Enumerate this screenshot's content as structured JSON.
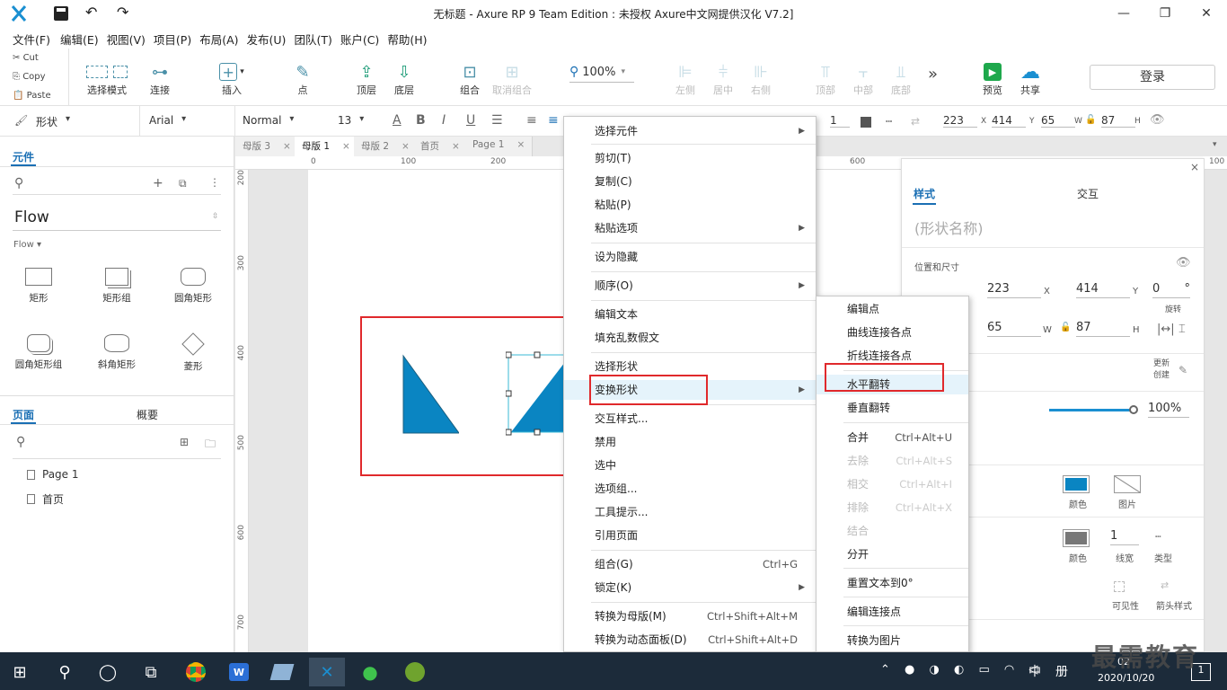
{
  "window": {
    "title": "无标题 - Axure RP 9 Team Edition : 未授权    Axure中文网提供汉化 V7.2]",
    "min": "—",
    "max": "❐",
    "close": "✕"
  },
  "menubar": [
    "文件(F)",
    "编辑(E)",
    "视图(V)",
    "项目(P)",
    "布局(A)",
    "发布(U)",
    "团队(T)",
    "账户(C)",
    "帮助(H)"
  ],
  "clipboard": {
    "cut": "Cut",
    "copy": "Copy",
    "paste": "Paste"
  },
  "toolbar": {
    "select_mode": "选择模式",
    "connect": "连接",
    "insert": "插入",
    "point": "点",
    "top": "顶层",
    "bottom": "底层",
    "group": "组合",
    "ungroup": "取消组合",
    "zoom": "100%",
    "left": "左侧",
    "center": "居中",
    "right": "右侧",
    "top_align": "顶部",
    "middle": "中部",
    "bottom_align": "底部",
    "more": "»",
    "preview": "预览",
    "share": "共享",
    "login": "登录"
  },
  "format": {
    "style": "形状",
    "font": "Arial",
    "weight": "Normal",
    "size": "13",
    "line_w": "1",
    "x": "223",
    "y": "414",
    "w": "65",
    "h": "87",
    "x_l": "X",
    "y_l": "Y",
    "w_l": "W",
    "h_l": "H"
  },
  "left": {
    "tab_widgets": "元件",
    "library": "Flow",
    "lib_sub": "Flow ▾",
    "widgets": [
      "矩形",
      "矩形组",
      "圆角矩形",
      "圆角矩形组",
      "斜角矩形",
      "菱形"
    ],
    "tab_pages": "页面",
    "tab_outline": "概要",
    "pages": [
      "Page 1",
      "首页"
    ]
  },
  "doctabs": [
    "母版 3",
    "母版 1",
    "母版 2",
    "首页",
    "Page 1"
  ],
  "ruler_h": [
    "0",
    "100",
    "200",
    "600",
    "100"
  ],
  "ruler_v": [
    "200",
    "300",
    "400",
    "500",
    "600",
    "700"
  ],
  "right": {
    "tab_style": "样式",
    "tab_interact": "交互",
    "shape_name": "(形状名称)",
    "pos_size": "位置和尺寸",
    "x": "223",
    "y": "414",
    "rot": "0",
    "deg": "°",
    "w": "65",
    "h": "87",
    "x_l": "X",
    "y_l": "Y",
    "rot_l": "旋转",
    "w_l": "W",
    "h_l": "H",
    "update_create": [
      "更新",
      "创建"
    ],
    "opacity": "100%",
    "fill_color": "颜色",
    "fill_image": "图片",
    "border_color": "颜色",
    "line_width_val": "1",
    "line_width": "线宽",
    "line_type": "类型",
    "visibility": "可见性",
    "arrow_style": "箭头样式",
    "fill_hex": "#0a85c2"
  },
  "context_menu": [
    {
      "label": "选择元件",
      "sub": true
    },
    {
      "label": "剪切(T)"
    },
    {
      "label": "复制(C)"
    },
    {
      "label": "粘贴(P)"
    },
    {
      "label": "粘贴选项",
      "sub": true
    },
    {
      "label": "设为隐藏"
    },
    {
      "label": "顺序(O)",
      "sub": true
    },
    {
      "label": "编辑文本"
    },
    {
      "label": "填充乱数假文"
    },
    {
      "label": "选择形状"
    },
    {
      "label": "变换形状",
      "sub": true
    },
    {
      "label": "交互样式..."
    },
    {
      "label": "禁用"
    },
    {
      "label": "选中"
    },
    {
      "label": "选项组..."
    },
    {
      "label": "工具提示..."
    },
    {
      "label": "引用页面"
    },
    {
      "label": "组合(G)",
      "shortcut": "Ctrl+G"
    },
    {
      "label": "锁定(K)",
      "sub": true
    },
    {
      "label": "转换为母版(M)",
      "shortcut": "Ctrl+Shift+Alt+M"
    },
    {
      "label": "转换为动态面板(D)",
      "shortcut": "Ctrl+Shift+Alt+D"
    }
  ],
  "submenu": [
    {
      "label": "编辑点"
    },
    {
      "label": "曲线连接各点"
    },
    {
      "label": "折线连接各点"
    },
    {
      "label": "水平翻转"
    },
    {
      "label": "垂直翻转"
    },
    {
      "label": "合并",
      "shortcut": "Ctrl+Alt+U"
    },
    {
      "label": "去除",
      "shortcut": "Ctrl+Alt+S",
      "disabled": true
    },
    {
      "label": "相交",
      "shortcut": "Ctrl+Alt+I",
      "disabled": true
    },
    {
      "label": "排除",
      "shortcut": "Ctrl+Alt+X",
      "disabled": true
    },
    {
      "label": "结合",
      "disabled": true
    },
    {
      "label": "分开"
    },
    {
      "label": "重置文本到0°"
    },
    {
      "label": "编辑连接点"
    },
    {
      "label": "转换为图片"
    }
  ],
  "taskbar": {
    "time": "02",
    "date": "2020/10/20",
    "ime": "中",
    "layout": "册",
    "watermark": "最需教育",
    "notif": "1"
  }
}
